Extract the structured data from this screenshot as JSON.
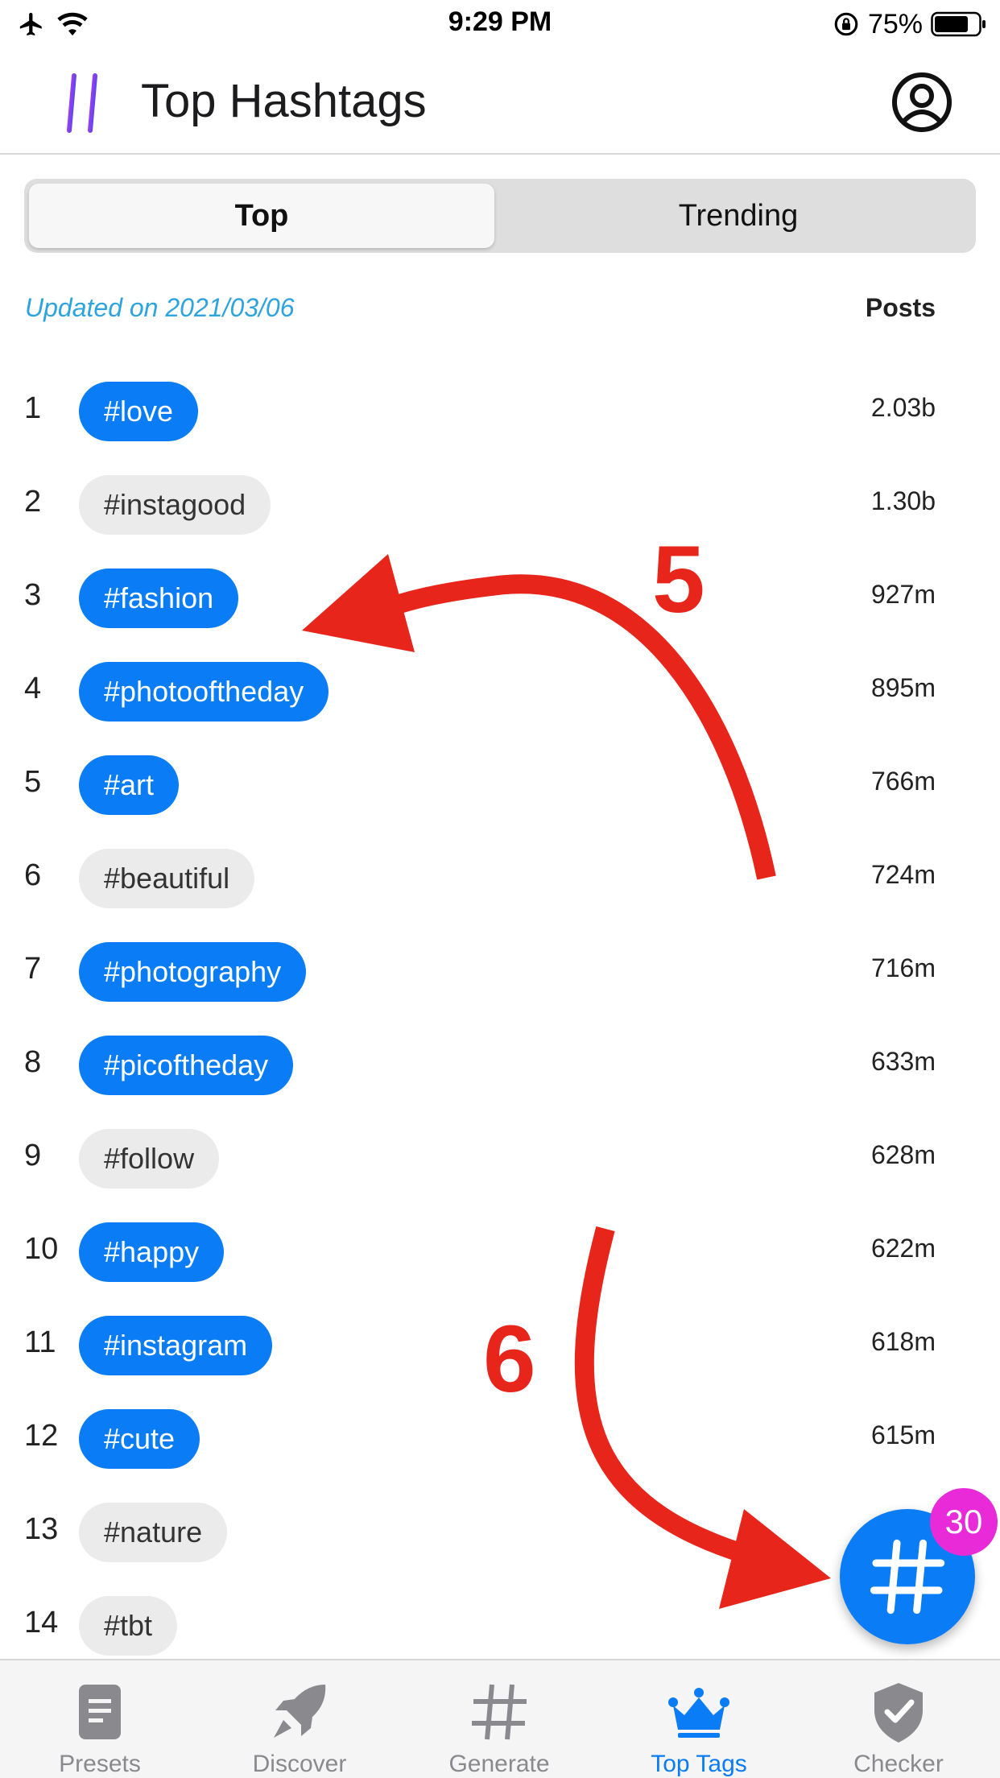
{
  "status_bar": {
    "time": "9:29 PM",
    "battery": "75%"
  },
  "header": {
    "title": "Top Hashtags"
  },
  "segmented": {
    "top": "Top",
    "trending": "Trending"
  },
  "meta": {
    "updated": "Updated on 2021/03/06",
    "posts_label": "Posts"
  },
  "hashtags": [
    {
      "rank": "1",
      "tag": "#love",
      "posts": "2.03b",
      "selected": true
    },
    {
      "rank": "2",
      "tag": "#instagood",
      "posts": "1.30b",
      "selected": false
    },
    {
      "rank": "3",
      "tag": "#fashion",
      "posts": "927m",
      "selected": true
    },
    {
      "rank": "4",
      "tag": "#photooftheday",
      "posts": "895m",
      "selected": true
    },
    {
      "rank": "5",
      "tag": "#art",
      "posts": "766m",
      "selected": true
    },
    {
      "rank": "6",
      "tag": "#beautiful",
      "posts": "724m",
      "selected": false
    },
    {
      "rank": "7",
      "tag": "#photography",
      "posts": "716m",
      "selected": true
    },
    {
      "rank": "8",
      "tag": "#picoftheday",
      "posts": "633m",
      "selected": true
    },
    {
      "rank": "9",
      "tag": "#follow",
      "posts": "628m",
      "selected": false
    },
    {
      "rank": "10",
      "tag": "#happy",
      "posts": "622m",
      "selected": true
    },
    {
      "rank": "11",
      "tag": "#instagram",
      "posts": "618m",
      "selected": true
    },
    {
      "rank": "12",
      "tag": "#cute",
      "posts": "615m",
      "selected": true
    },
    {
      "rank": "13",
      "tag": "#nature",
      "posts": "",
      "selected": false
    },
    {
      "rank": "14",
      "tag": "#tbt",
      "posts": "",
      "selected": false
    }
  ],
  "annotations": {
    "step5": "5",
    "step6": "6"
  },
  "fab": {
    "badge": "30",
    "icon": "hashtag-icon"
  },
  "tab_bar": {
    "items": [
      {
        "label": "Presets",
        "icon": "document-icon"
      },
      {
        "label": "Discover",
        "icon": "rocket-icon"
      },
      {
        "label": "Generate",
        "icon": "hashtag-icon"
      },
      {
        "label": "Top Tags",
        "icon": "crown-icon",
        "active": true
      },
      {
        "label": "Checker",
        "icon": "shield-check-icon"
      }
    ]
  },
  "colors": {
    "accent": "#0a7cf5",
    "annotation": "#e8251a",
    "badge": "#e82ad9",
    "updated_text": "#2ea4dc"
  }
}
